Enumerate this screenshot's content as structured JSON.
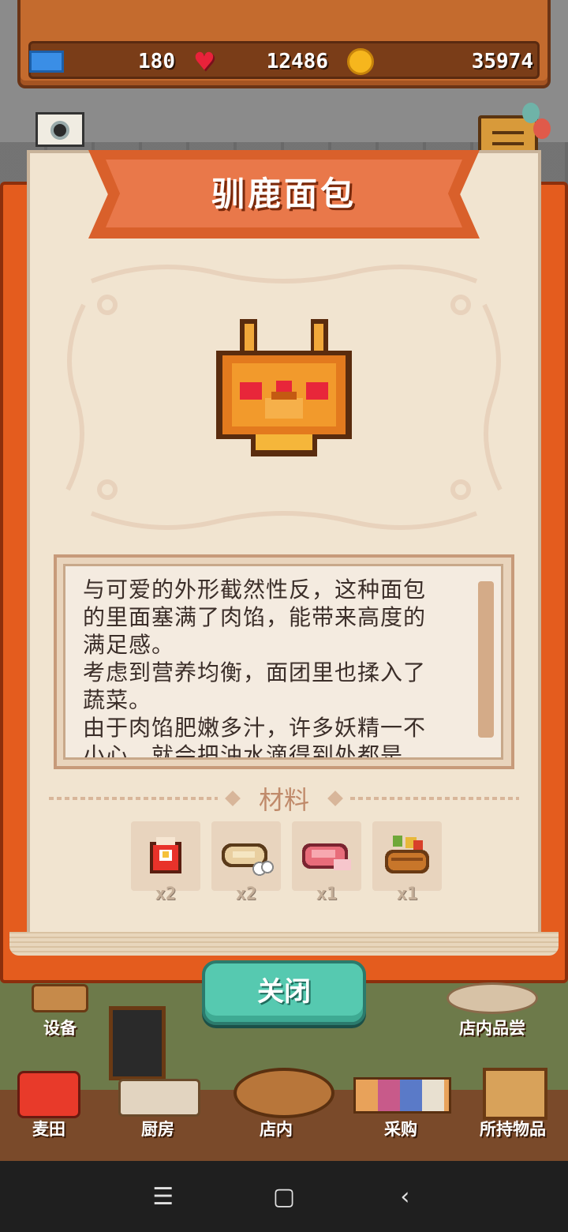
{
  "resources": {
    "tickets": "180",
    "hearts": "12486",
    "coins": "35974",
    "icons": [
      "ticket-icon",
      "heart-icon",
      "coin-icon"
    ]
  },
  "camera": {
    "label": "照相",
    "icon": "camera-icon"
  },
  "recipe": {
    "title": "驯鹿面包",
    "description": "与可爱的外形截然性反，这种面包\n的里面塞满了肉馅，能带来高度的\n满足感。\n考虑到营养均衡，面团里也揉入了\n蔬菜。\n由于肉馅肥嫩多汁，许多妖精一不\n小心，就会把油水滴得到处都是。",
    "materials_label": "材料",
    "materials": [
      {
        "icon": "flour-bag-icon",
        "qty": "x2"
      },
      {
        "icon": "eggs-icon",
        "qty": "x2"
      },
      {
        "icon": "meat-icon",
        "qty": "x1"
      },
      {
        "icon": "vegetable-basket-icon",
        "qty": "x1"
      }
    ]
  },
  "close_label": "关闭",
  "bottom_nav": {
    "equipment": "设备",
    "tasting": "店内品尝",
    "field": "麦田",
    "kitchen": "厨房",
    "store": "店内",
    "purchase": "采购",
    "items": "所持物品"
  },
  "colors": {
    "banner": "#d9602b",
    "cover": "#e45c1e",
    "page": "#f1e4d0",
    "close_button": "#56c9b0"
  }
}
